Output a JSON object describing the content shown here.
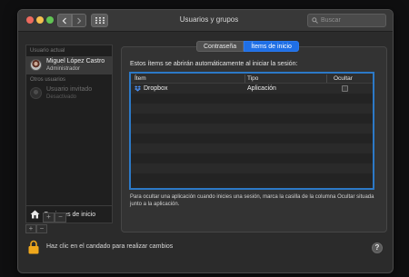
{
  "window": {
    "title": "Usuarios y grupos",
    "search_placeholder": "Buscar"
  },
  "sidebar": {
    "current_section": "Usuario actual",
    "current_user": {
      "name": "Miguel López Castro",
      "role": "Administrador"
    },
    "other_section": "Otros usuarios",
    "guest_user": {
      "name": "Usuario invitado",
      "role": "Desactivado"
    },
    "login_options_label": "Opciones de inicio",
    "add_label": "+",
    "remove_label": "−"
  },
  "tabs": [
    {
      "label": "Contraseña",
      "active": false
    },
    {
      "label": "Ítems de inicio",
      "active": true
    }
  ],
  "login_items": {
    "intro": "Estos ítems se abrirán automáticamente al iniciar la sesión:",
    "columns": {
      "item": "Ítem",
      "type": "Tipo",
      "hide": "Ocultar"
    },
    "rows": [
      {
        "item": "Dropbox",
        "type": "Aplicación",
        "hidden": false,
        "icon": "dropbox-icon"
      }
    ],
    "hint": "Para ocultar una aplicación cuando inicies una sesión, marca la casilla de la columna Ocultar situada junto a la aplicación.",
    "add_label": "+",
    "remove_label": "−"
  },
  "footer": {
    "lock_text": "Haz clic en el candado para realizar cambios",
    "help_label": "?"
  },
  "colors": {
    "accent": "#1f6fe5",
    "table_focus": "#2c79c7",
    "lock": "#f0a81c"
  }
}
